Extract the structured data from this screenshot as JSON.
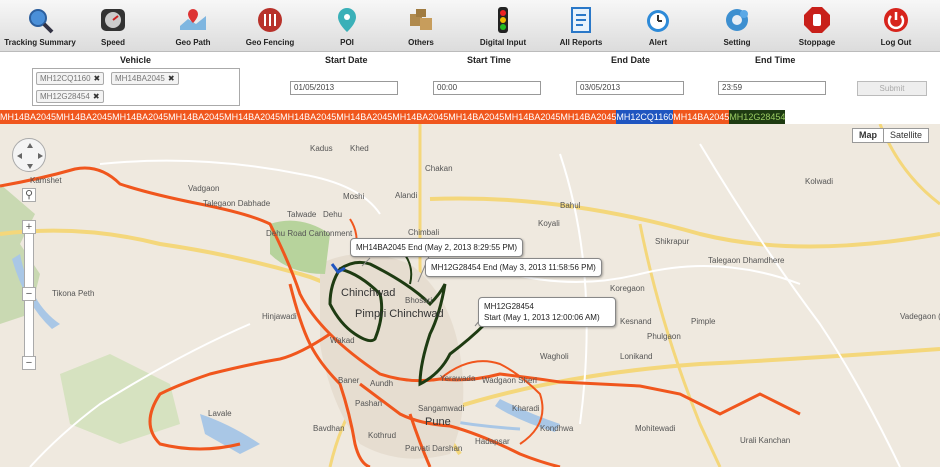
{
  "toolbar": {
    "items": [
      {
        "label": "Tracking Summary",
        "icon": "magnifier-icon"
      },
      {
        "label": "Speed",
        "icon": "speedometer-icon"
      },
      {
        "label": "Geo Path",
        "icon": "map-pin-icon"
      },
      {
        "label": "Geo Fencing",
        "icon": "fence-icon"
      },
      {
        "label": "POI",
        "icon": "poi-pin-icon"
      },
      {
        "label": "Others",
        "icon": "boxes-icon"
      },
      {
        "label": "Digital Input",
        "icon": "traffic-light-icon"
      },
      {
        "label": "All Reports",
        "icon": "report-icon"
      },
      {
        "label": "Alert",
        "icon": "alarm-clock-icon"
      },
      {
        "label": "Setting",
        "icon": "gear-icon"
      },
      {
        "label": "Stoppage",
        "icon": "stop-hand-icon"
      },
      {
        "label": "Log Out",
        "icon": "power-icon"
      }
    ]
  },
  "form": {
    "vehicle_label": "Vehicle",
    "vehicle_chips": [
      "MH12CQ1160",
      "MH14BA2045",
      "MH12G28454"
    ],
    "start_date_label": "Start Date",
    "start_date_value": "01/05/2013",
    "start_time_label": "Start Time",
    "start_time_value": "00:00",
    "end_date_label": "End Date",
    "end_date_value": "03/05/2013",
    "end_time_label": "End Time",
    "end_time_value": "23:59",
    "submit_label": "Submit"
  },
  "legend": {
    "segments": [
      {
        "text": "MH14BA2045MH14BA2045MH14BA2045MH14BA2045MH14BA2045MH14BA2045MH14BA2045MH14BA2045MH14BA2045MH14BA2045MH14BA2045",
        "color": "#f0561d"
      },
      {
        "text": "MH12CQ1160",
        "color": "#1f55c0"
      },
      {
        "text": "MH14BA2045",
        "color": "#f0561d"
      },
      {
        "text": "MH12G28454",
        "color": "#1e3b12"
      }
    ]
  },
  "map": {
    "map_type_map": "Map",
    "map_type_satellite": "Satellite",
    "callouts": [
      {
        "text": "MH14BA2045 End (May 2, 2013 8:29:55 PM)"
      },
      {
        "text": "MH12G28454 End (May 3, 2013 11:58:56 PM)"
      },
      {
        "line1": "MH12G28454",
        "line2": "Start (May 1, 2013 12:00:06 AM)"
      }
    ],
    "places": [
      "Vadgaon",
      "Talegaon Dabhade",
      "Talwade",
      "Dehu",
      "Moshi",
      "Chakan",
      "Alandi",
      "Chimbali",
      "Koyali",
      "Bahul",
      "Shikrapur",
      "Talegaon Dhamdhere",
      "Koregaon",
      "Chinchwad",
      "Pimpri Chinchwad",
      "Bhosari",
      "Hinjawadi",
      "Wakad",
      "Aundh",
      "Baner",
      "Pashan",
      "Kothrud",
      "Pune",
      "Sangamwadi",
      "Yerawada",
      "Wadgaon Sheri",
      "Wagholi",
      "Kharadi",
      "Hadapsar",
      "Parvati Darshan",
      "Dehu Road Cantonment",
      "Tikona Peth",
      "Kamshet",
      "Lavale",
      "Bavdhan",
      "Phulgaon",
      "Kesnand",
      "Lonikand",
      "Pimple",
      "Vadegaon (Paga)",
      "Kondhwa",
      "Mohitewadi",
      "Khed",
      "Kadus",
      "Urali Kanchan",
      "Kolwadi"
    ]
  }
}
